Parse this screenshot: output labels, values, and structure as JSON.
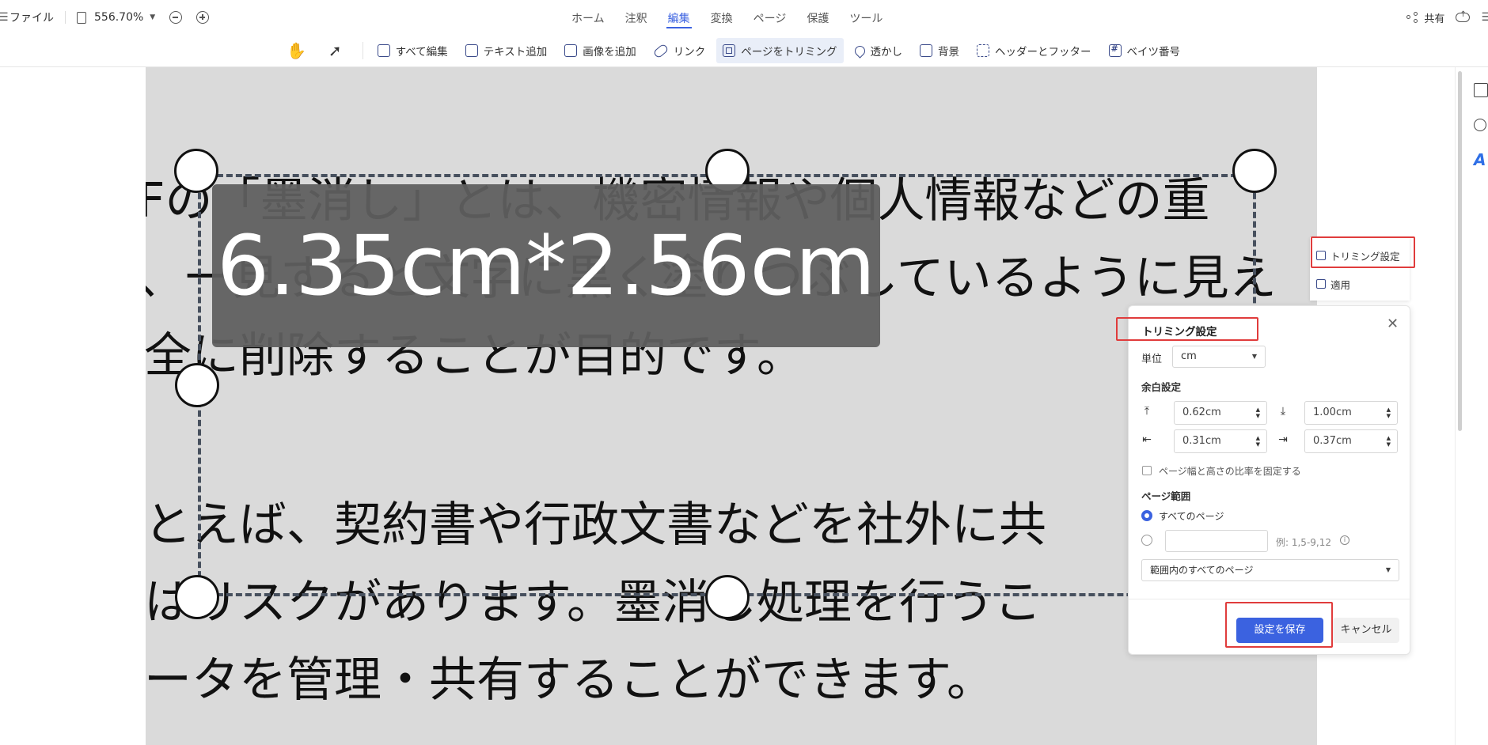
{
  "menubar": {
    "file_label": "ファイル",
    "zoom": "556.70%",
    "tabs": [
      {
        "label": "ホーム"
      },
      {
        "label": "注釈"
      },
      {
        "label": "編集"
      },
      {
        "label": "変換"
      },
      {
        "label": "ページ"
      },
      {
        "label": "保護"
      },
      {
        "label": "ツール"
      }
    ],
    "active_tab": "編集",
    "share_label": "共有"
  },
  "toolbar": {
    "items": [
      {
        "label": "すべて編集",
        "icon": "edit-all-icon"
      },
      {
        "label": "テキスト追加",
        "icon": "add-text-icon"
      },
      {
        "label": "画像を追加",
        "icon": "add-image-icon"
      },
      {
        "label": "リンク",
        "icon": "link-icon"
      },
      {
        "label": "ページをトリミング",
        "icon": "crop-icon",
        "active": true
      },
      {
        "label": "透かし",
        "icon": "watermark-icon"
      },
      {
        "label": "背景",
        "icon": "background-icon"
      },
      {
        "label": "ヘッダーとフッター",
        "icon": "header-footer-icon"
      },
      {
        "label": "ベイツ番号",
        "icon": "bates-number-icon"
      }
    ]
  },
  "document": {
    "lines": [
      "Fの「墨消し」とは、機密情報や個人情報などの重",
      "、一見すると文字に黒く塗りつぶしているように見え",
      "全に削除することが目的です。",
      "とえば、契約書や行政文書などを社外に共",
      "はリスクがあります。墨消し処理を行うこ",
      "ータを管理・共有することができます。"
    ],
    "page_color": "#dadada"
  },
  "crop_tooltip": "6.35cm*2.56cm",
  "crop_mini": {
    "settings_label": "トリミング設定",
    "apply_label": "適用"
  },
  "trim_panel": {
    "title": "トリミング設定",
    "unit_label": "単位",
    "unit_value": "cm",
    "margin_section": "余白設定",
    "margins": {
      "top": "0.62cm",
      "bottom": "1.00cm",
      "left": "0.31cm",
      "right": "0.37cm"
    },
    "lock_ratio_label": "ページ幅と高さの比率を固定する",
    "page_range_section": "ページ範囲",
    "all_pages_label": "すべてのページ",
    "range_hint": "例: 1,5-9,12",
    "subset_value": "範囲内のすべてのページ",
    "save_label": "設定を保存",
    "cancel_label": "キャンセル"
  },
  "colors": {
    "accent": "#3b62e0",
    "highlight": "#e03c3c"
  }
}
